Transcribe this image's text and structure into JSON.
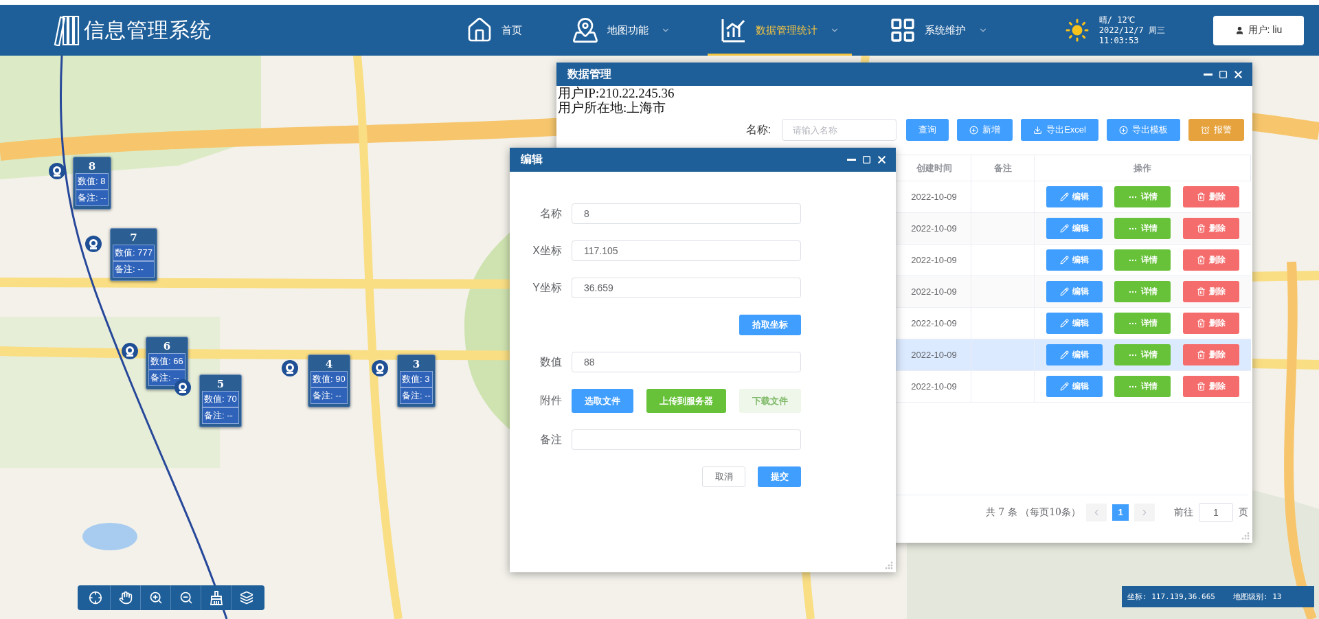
{
  "header": {
    "title": "信息管理系统",
    "nav": [
      {
        "label": "首页",
        "dropdown": false,
        "selected": false
      },
      {
        "label": "地图功能",
        "dropdown": true,
        "selected": false
      },
      {
        "label": "数据管理统计",
        "dropdown": true,
        "selected": true
      },
      {
        "label": "系统维护",
        "dropdown": true,
        "selected": false
      }
    ],
    "weather": {
      "condition": "晴/ 12℃",
      "date": "2022/12/7 周三",
      "time": "11:03:53"
    },
    "user_button": "用户: liu"
  },
  "map": {
    "kind": "picture",
    "markers": [
      {
        "title": "8",
        "lines": [
          "数值: 8",
          "备注: --"
        ]
      },
      {
        "title": "7",
        "lines": [
          "数值: 777",
          "备注: --"
        ]
      },
      {
        "title": "6",
        "lines": [
          "数值: 66",
          "备注: --"
        ]
      },
      {
        "title": "5",
        "lines": [
          "数值: 70",
          "备注: --"
        ]
      },
      {
        "title": "4",
        "lines": [
          "数值: 90",
          "备注: --"
        ]
      },
      {
        "title": "3",
        "lines": [
          "数值: 3",
          "备注: --"
        ]
      }
    ],
    "status": {
      "coordinates": "坐标: 117.139,36.665",
      "zoom_level": "地图级别: 13"
    }
  },
  "data_window": {
    "title": "数据管理",
    "info": [
      "用户IP:210.22.245.36",
      "用户所在地:上海市"
    ],
    "search": {
      "label": "名称:",
      "placeholder": "请输入名称"
    },
    "buttons": [
      {
        "label": "查询",
        "kind": "primary"
      },
      {
        "label": "新增",
        "kind": "primary"
      },
      {
        "label": "导出Excel",
        "kind": "primary"
      },
      {
        "label": "导出模板",
        "kind": "primary"
      },
      {
        "label": "报警",
        "kind": "warning"
      }
    ],
    "table": {
      "columns": [
        "创建时间",
        "备注",
        "操作"
      ],
      "rows": [
        {
          "created": "2022-10-09",
          "selected": false,
          "actions": [
            {
              "label": "编辑",
              "kind": "edit"
            },
            {
              "label": "详情",
              "kind": "detail"
            },
            {
              "label": "删除",
              "kind": "delete"
            }
          ]
        },
        {
          "created": "2022-10-09",
          "selected": false,
          "actions": [
            {
              "label": "编辑",
              "kind": "edit"
            },
            {
              "label": "详情",
              "kind": "detail"
            },
            {
              "label": "删除",
              "kind": "delete"
            }
          ]
        },
        {
          "created": "2022-10-09",
          "selected": false,
          "actions": [
            {
              "label": "编辑",
              "kind": "edit"
            },
            {
              "label": "详情",
              "kind": "detail"
            },
            {
              "label": "删除",
              "kind": "delete"
            }
          ]
        },
        {
          "created": "2022-10-09",
          "selected": false,
          "actions": [
            {
              "label": "编辑",
              "kind": "edit"
            },
            {
              "label": "详情",
              "kind": "detail"
            },
            {
              "label": "删除",
              "kind": "delete"
            }
          ]
        },
        {
          "created": "2022-10-09",
          "selected": false,
          "actions": [
            {
              "label": "编辑",
              "kind": "edit"
            },
            {
              "label": "详情",
              "kind": "detail"
            },
            {
              "label": "删除",
              "kind": "delete"
            }
          ]
        },
        {
          "created": "2022-10-09",
          "selected": true,
          "actions": [
            {
              "label": "编辑",
              "kind": "edit"
            },
            {
              "label": "详情",
              "kind": "detail"
            },
            {
              "label": "删除",
              "kind": "delete"
            }
          ]
        },
        {
          "created": "2022-10-09",
          "selected": false,
          "actions": [
            {
              "label": "编辑",
              "kind": "edit"
            },
            {
              "label": "详情",
              "kind": "detail"
            },
            {
              "label": "删除",
              "kind": "delete"
            }
          ]
        }
      ]
    },
    "pagination": {
      "total": "共 7 条 （每页10条）",
      "pages": [
        {
          "label": "1",
          "selected": true
        }
      ],
      "goto_label": "前往",
      "goto_value": "1",
      "page_suffix": "页"
    }
  },
  "edit_dialog": {
    "title": "编辑",
    "rows": [
      {
        "kind": "input",
        "label": "名称",
        "value": "8"
      },
      {
        "kind": "input",
        "label": "X坐标",
        "value": "117.105"
      },
      {
        "kind": "input",
        "label": "Y坐标",
        "value": "36.659"
      },
      {
        "kind": "action",
        "button": "拾取坐标"
      },
      {
        "kind": "input",
        "label": "数值",
        "value": "88"
      },
      {
        "kind": "files",
        "label": "附件",
        "buttons": [
          {
            "label": "选取文件",
            "kind": "primary",
            "disabled": false
          },
          {
            "label": "上传到服务器",
            "kind": "success",
            "disabled": false
          },
          {
            "label": "下载文件",
            "kind": "success",
            "disabled": true
          }
        ]
      },
      {
        "kind": "input",
        "label": "备注"
      }
    ],
    "footer": [
      {
        "label": "取消",
        "kind": "default"
      },
      {
        "label": "提交",
        "kind": "primary"
      }
    ]
  }
}
